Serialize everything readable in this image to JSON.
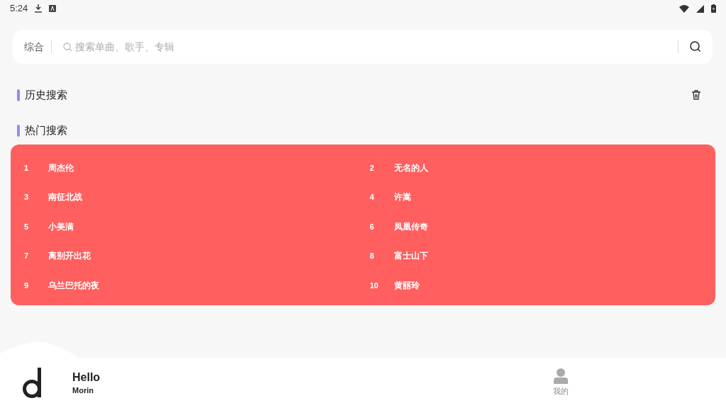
{
  "status_bar": {
    "time": "5:24"
  },
  "search": {
    "scope": "综合",
    "placeholder": "搜索单曲、歌手、专辑"
  },
  "history": {
    "title": "历史搜索"
  },
  "hot": {
    "title": "热门搜索",
    "items": [
      {
        "rank": "1",
        "text": "周杰伦"
      },
      {
        "rank": "2",
        "text": "无名的人"
      },
      {
        "rank": "3",
        "text": "南征北战"
      },
      {
        "rank": "4",
        "text": "许嵩"
      },
      {
        "rank": "5",
        "text": "小美满"
      },
      {
        "rank": "6",
        "text": "凤凰传奇"
      },
      {
        "rank": "7",
        "text": "离别开出花"
      },
      {
        "rank": "8",
        "text": "富士山下"
      },
      {
        "rank": "9",
        "text": "乌兰巴托的夜"
      },
      {
        "rank": "10",
        "text": "黄丽玲"
      }
    ]
  },
  "player": {
    "title": "Hello",
    "artist": "Morin"
  },
  "nav": [
    {
      "label": "我的"
    }
  ]
}
